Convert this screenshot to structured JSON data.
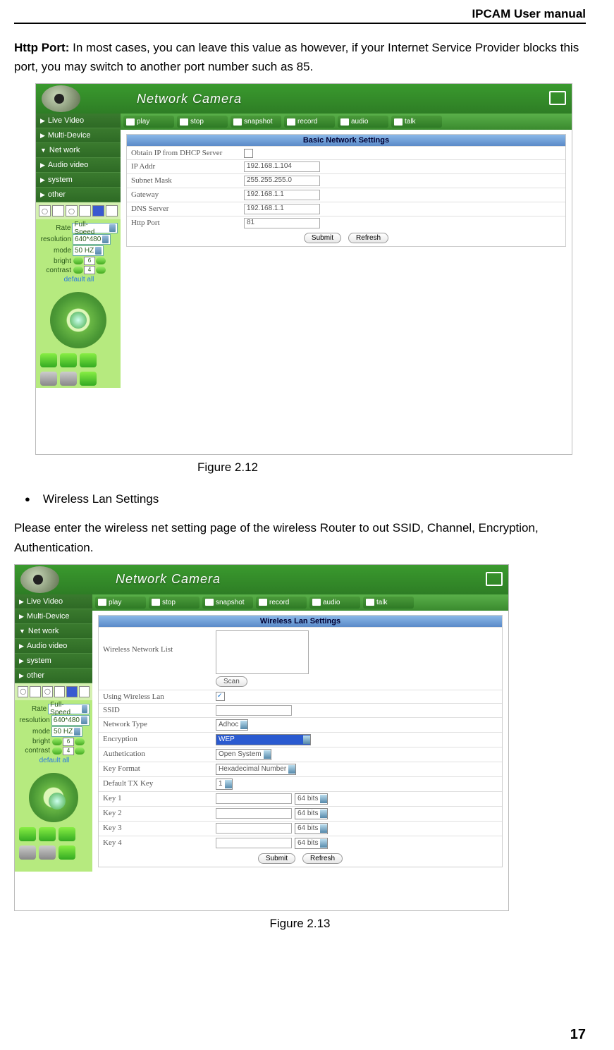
{
  "header": {
    "title": "IPCAM User manual"
  },
  "intro": {
    "bold": "Http Port: ",
    "rest": "In most cases, you can leave this value as however, if your Internet Service Provider blocks this port, you may switch to another port number such as 85."
  },
  "figure1_caption": "Figure 2.12",
  "wireless_heading": "Wireless Lan Settings",
  "wireless_text": "Please enter the wireless net setting page of the wireless Router to out SSID, Channel, Encryption, Authentication.",
  "figure2_caption": "Figure 2.13",
  "page_number": "17",
  "app": {
    "title": "Network Camera",
    "watermark": "Network Ca",
    "nav": {
      "live": "Live Video",
      "multi": "Multi-Device",
      "net": "Net work",
      "av": "Audio video",
      "sys": "system",
      "other": "other"
    },
    "ctrls": {
      "rate_label": "Rate",
      "rate_val": "Full-Speed",
      "res_label": "resolution",
      "res_val": "640*480",
      "mode_label": "mode",
      "mode_val": "50 HZ",
      "bright_label": "bright",
      "bright_val": "6",
      "contrast_label": "contrast",
      "contrast_val": "4",
      "default": "default all"
    },
    "toolbar": {
      "play": "play",
      "stop": "stop",
      "snapshot": "snapshot",
      "record": "record",
      "audio": "audio",
      "talk": "talk"
    },
    "basic_net": {
      "title": "Basic Network Settings",
      "dhcp_label": "Obtain IP from DHCP Server",
      "ip_label": "IP Addr",
      "ip_val": "192.168.1.104",
      "mask_label": "Subnet Mask",
      "mask_val": "255.255.255.0",
      "gw_label": "Gateway",
      "gw_val": "192.168.1.1",
      "dns_label": "DNS Server",
      "dns_val": "192.168.1.1",
      "http_label": "Http Port",
      "http_val": "81",
      "submit": "Submit",
      "refresh": "Refresh"
    },
    "wlan": {
      "title": "Wireless Lan Settings",
      "list_label": "Wireless Network List",
      "scan": "Scan",
      "using_label": "Using Wireless Lan",
      "ssid_label": "SSID",
      "ssid_val": "",
      "nettype_label": "Network Type",
      "nettype_val": "Adhoc",
      "enc_label": "Encryption",
      "enc_val": "WEP",
      "auth_label": "Authetication",
      "auth_val": "Open System",
      "keyfmt_label": "Key Format",
      "keyfmt_val": "Hexadecimal Number",
      "deftx_label": "Default TX Key",
      "deftx_val": "1",
      "key1_label": "Key 1",
      "key2_label": "Key 2",
      "key3_label": "Key 3",
      "key4_label": "Key 4",
      "keybits": "64 bits",
      "submit": "Submit",
      "refresh": "Refresh"
    }
  }
}
